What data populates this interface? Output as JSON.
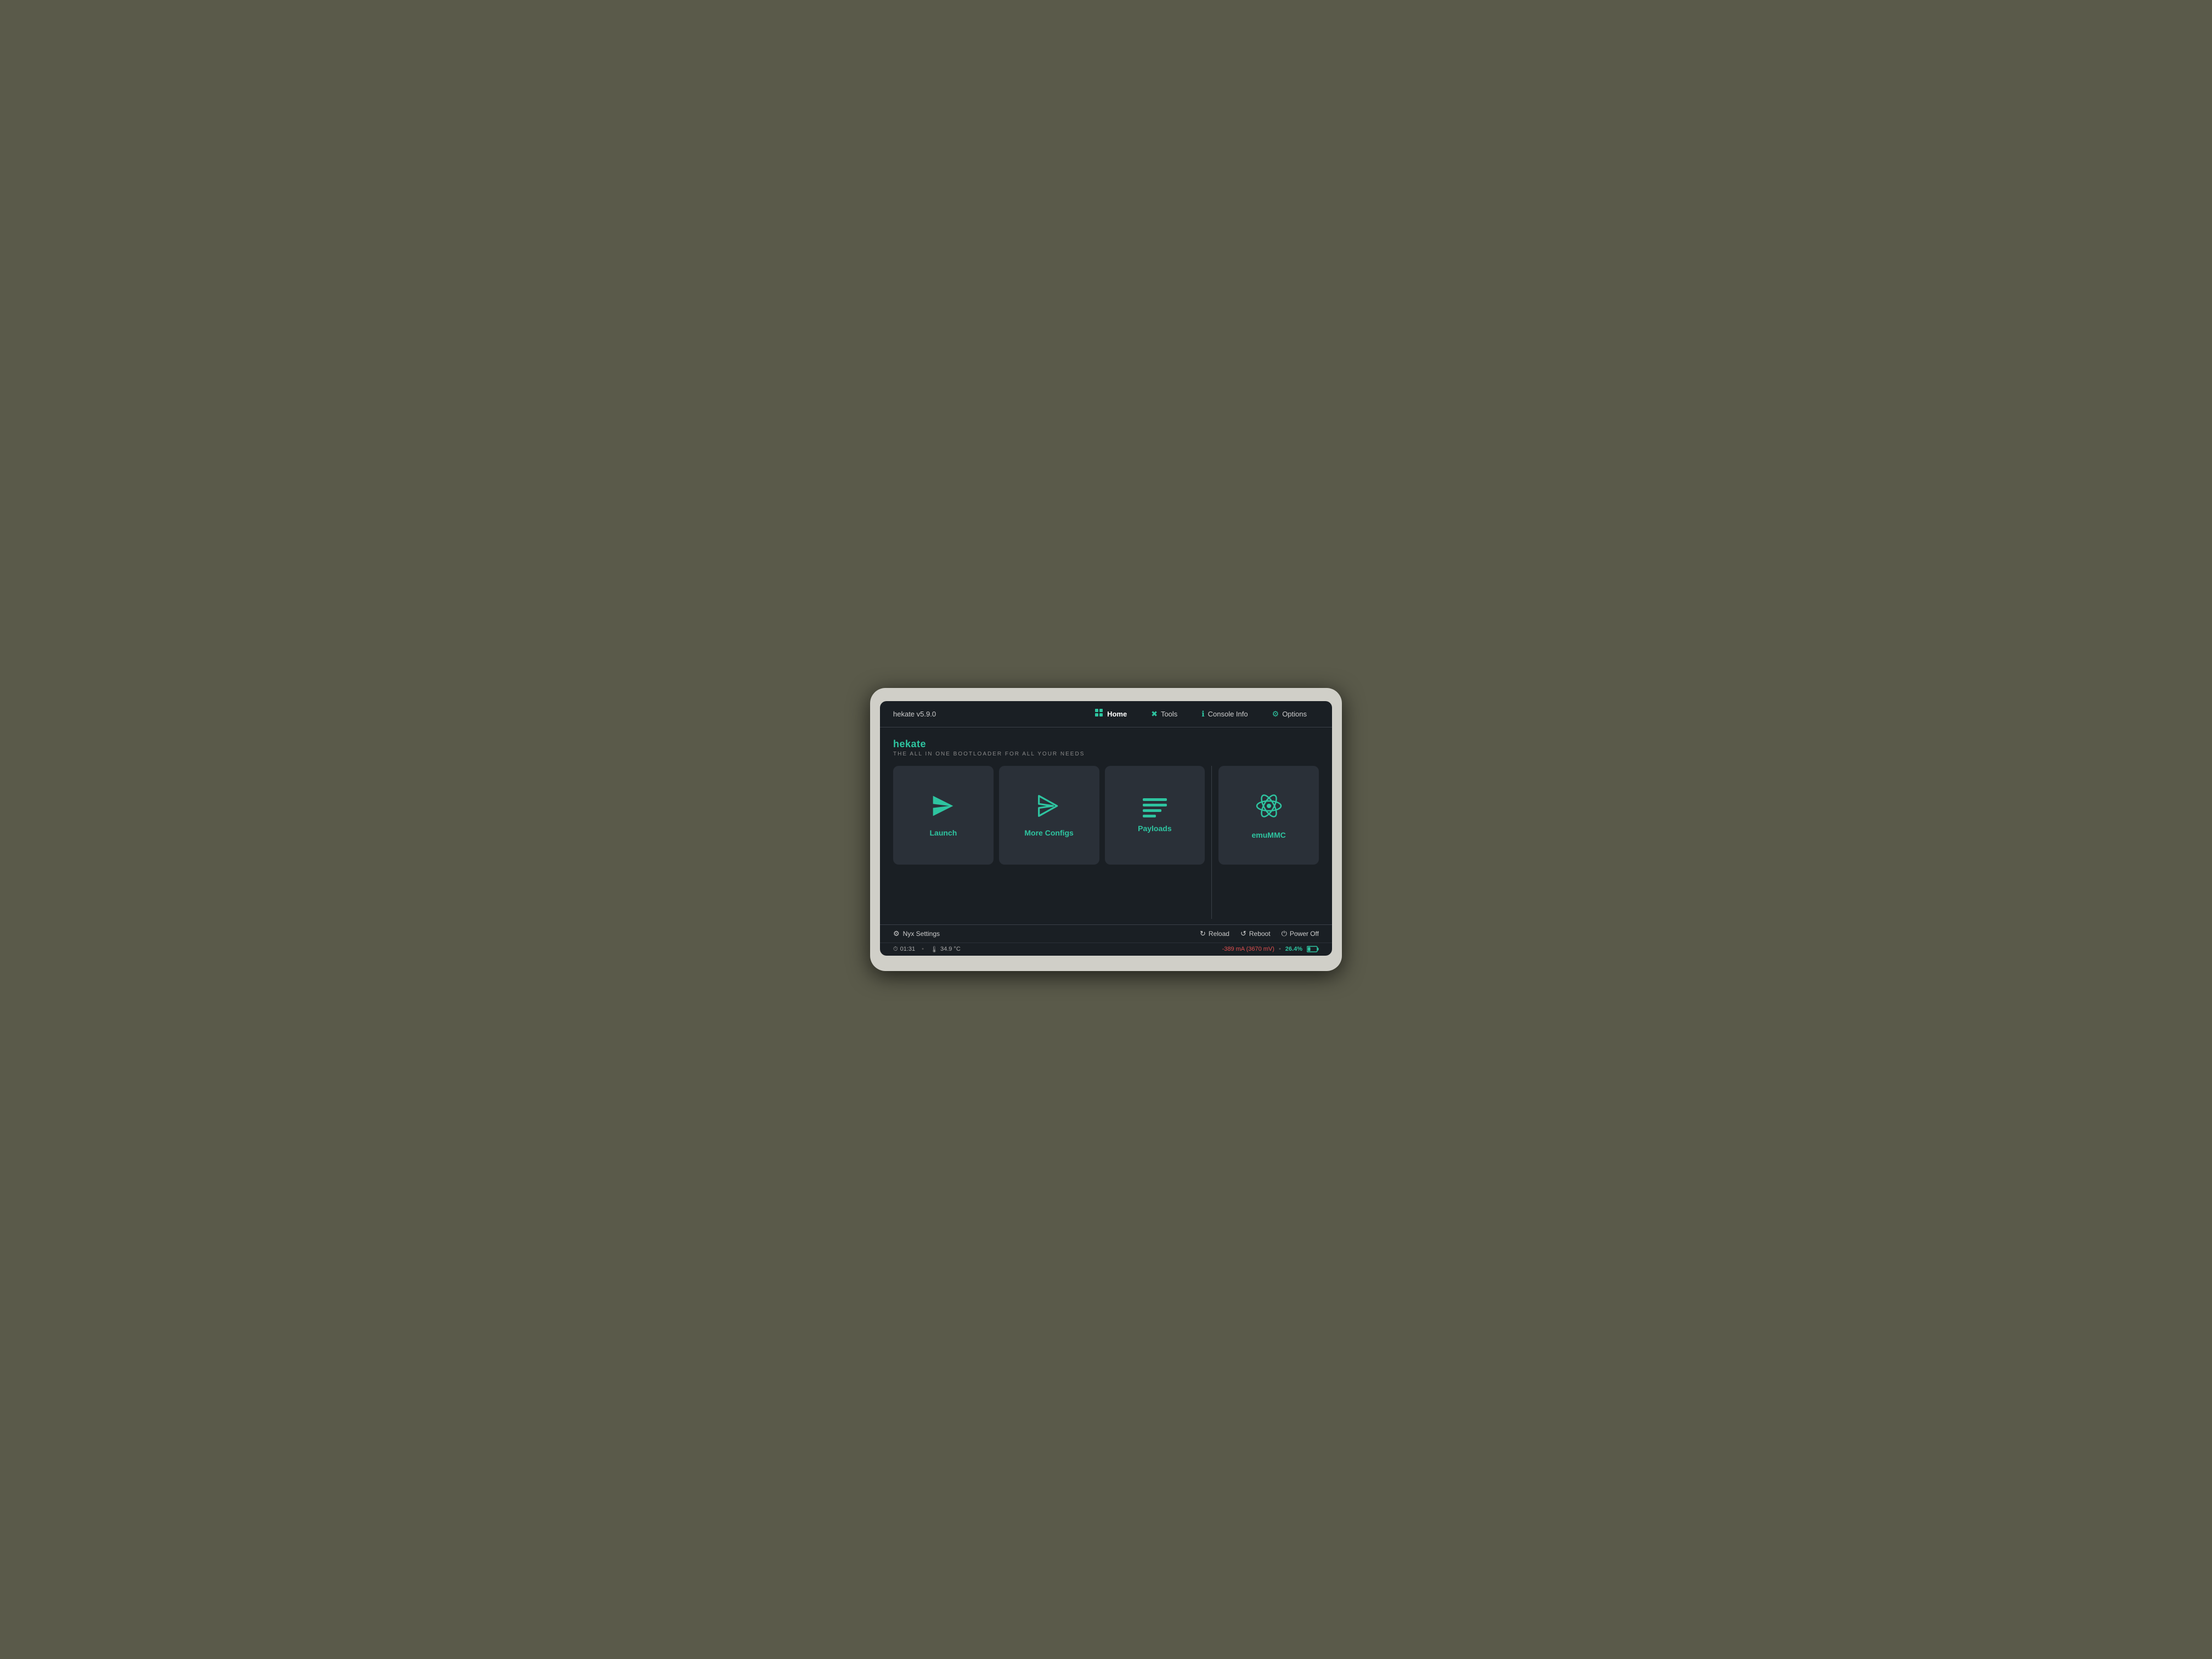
{
  "device": {
    "brand": "hekate v5.9.0"
  },
  "navbar": {
    "brand": "hekate v5.9.0",
    "items": [
      {
        "id": "home",
        "label": "Home",
        "icon": "grid",
        "active": true
      },
      {
        "id": "tools",
        "label": "Tools",
        "icon": "wrench",
        "active": false
      },
      {
        "id": "console-info",
        "label": "Console Info",
        "icon": "info",
        "active": false
      },
      {
        "id": "options",
        "label": "Options",
        "icon": "gear",
        "active": false
      }
    ]
  },
  "app": {
    "title": "hekate",
    "subtitle": "THE ALL IN ONE BOOTLOADER FOR ALL YOUR NEEDS"
  },
  "cards": [
    {
      "id": "launch",
      "label": "Launch",
      "icon": "launch"
    },
    {
      "id": "more-configs",
      "label": "More Configs",
      "icon": "launch-outline"
    },
    {
      "id": "payloads",
      "label": "Payloads",
      "icon": "lines"
    },
    {
      "id": "emunand",
      "label": "emuMMC",
      "icon": "atom"
    }
  ],
  "bottom": {
    "nyx_settings": "Nyx Settings",
    "reload": "Reload",
    "reboot": "Reboot",
    "power_off": "Power Off"
  },
  "status": {
    "time": "01:31",
    "temp": "34.9 °C",
    "current": "-389 mA (3670 mV)",
    "battery_pct": "26.4%"
  }
}
